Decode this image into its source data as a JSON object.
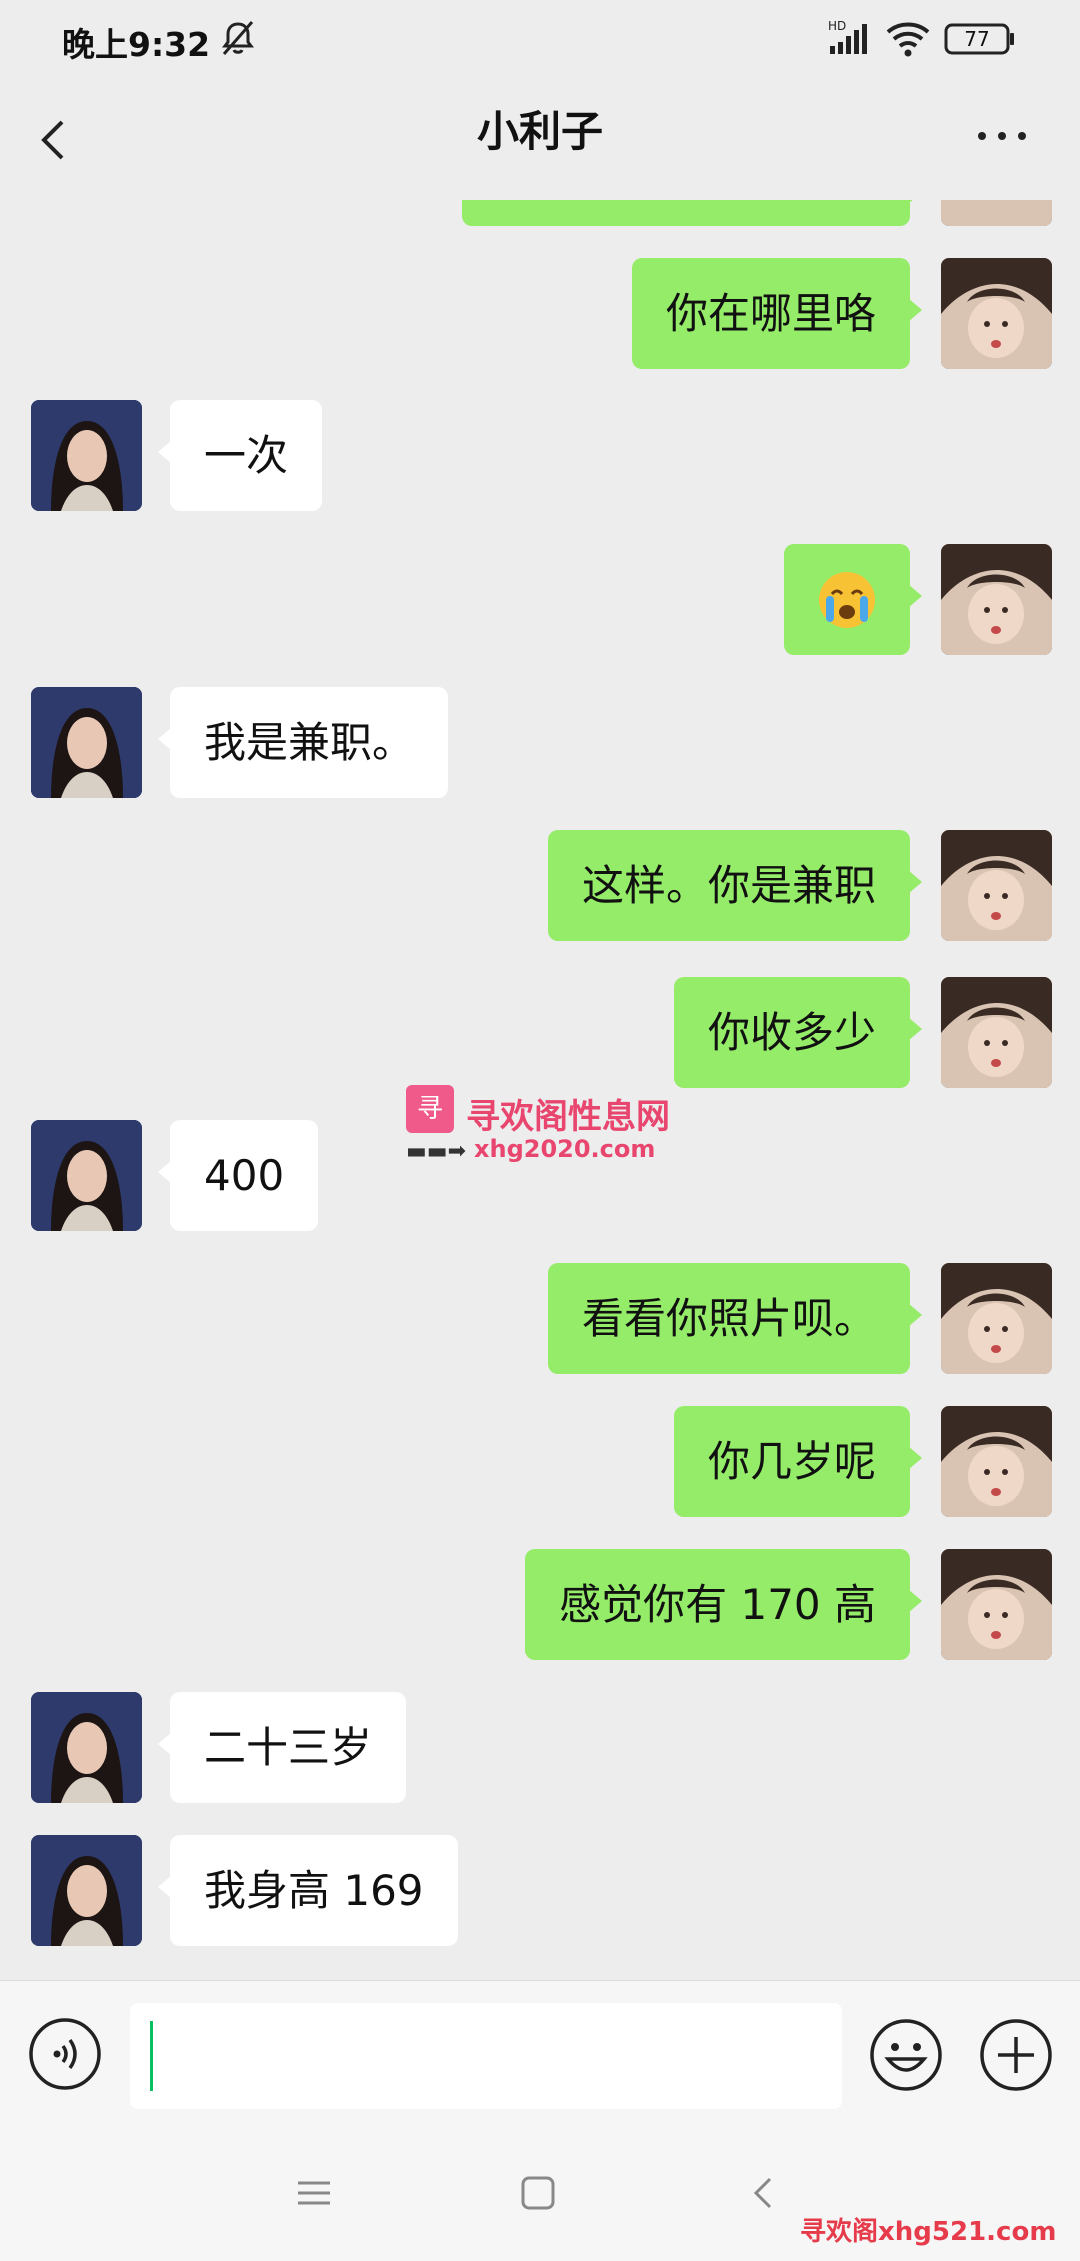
{
  "status_bar": {
    "time": "晚上9:32",
    "battery": "77",
    "icons": [
      "mute-icon",
      "hd-signal-icon",
      "wifi-icon",
      "battery-icon"
    ]
  },
  "header": {
    "title": "小利子",
    "back_icon": "chevron-left-icon",
    "more_icon": "more-dots-icon"
  },
  "messages": [
    {
      "sender": "me",
      "text": "你在哪里咯"
    },
    {
      "sender": "her",
      "text": "一次"
    },
    {
      "sender": "me",
      "text": "😭"
    },
    {
      "sender": "her",
      "text": "我是兼职。"
    },
    {
      "sender": "me",
      "text": "这样。你是兼职"
    },
    {
      "sender": "me",
      "text": "你收多少"
    },
    {
      "sender": "her",
      "text": "400"
    },
    {
      "sender": "me",
      "text": "看看你照片呗。"
    },
    {
      "sender": "me",
      "text": "你几岁呢"
    },
    {
      "sender": "me",
      "text": "感觉你有 170 高"
    },
    {
      "sender": "her",
      "text": "二十三岁"
    },
    {
      "sender": "her",
      "text": "我身高 169"
    }
  ],
  "watermark": {
    "logo_text": "寻",
    "title": "寻欢阁性息网",
    "url": "xhg2020.com"
  },
  "input_bar": {
    "value": "",
    "voice_icon": "voice-icon",
    "emoji_icon": "emoji-icon",
    "plus_icon": "plus-icon"
  },
  "nav_bar": {
    "footer_watermark": "寻欢阁xhg521.com"
  },
  "colors": {
    "background": "#ededed",
    "my_bubble": "#95ec69",
    "her_bubble": "#ffffff",
    "cursor": "#07c160",
    "watermark": "#e8466f"
  }
}
